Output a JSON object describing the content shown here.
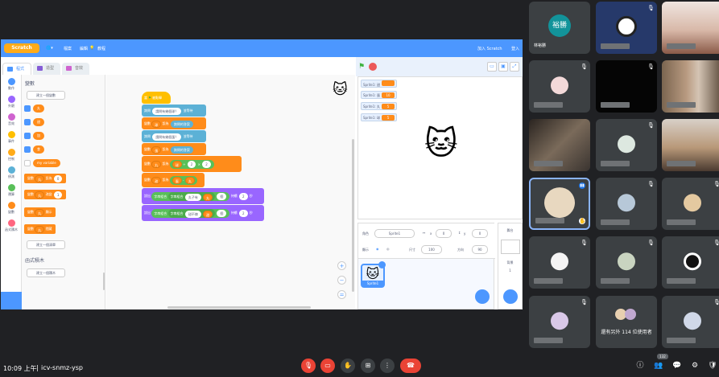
{
  "scratch": {
    "logo": "Scratch",
    "menu": {
      "file": "檔案",
      "edit": "編輯",
      "tutorials": "教程",
      "signup": "加入 Scratch",
      "signin": "登入"
    },
    "tabs": {
      "code": "程式",
      "costumes": "造型",
      "sounds": "音效"
    },
    "categories": [
      {
        "label": "動作",
        "color": "#4c97ff"
      },
      {
        "label": "外觀",
        "color": "#9966ff"
      },
      {
        "label": "音效",
        "color": "#cf63cf"
      },
      {
        "label": "事件",
        "color": "#ffbf00"
      },
      {
        "label": "控制",
        "color": "#ffab19"
      },
      {
        "label": "偵測",
        "color": "#5cb1d6"
      },
      {
        "label": "運算",
        "color": "#59c059"
      },
      {
        "label": "變數",
        "color": "#ff8c1a"
      },
      {
        "label": "函式積木",
        "color": "#ff6680"
      }
    ],
    "palette": {
      "heading": "變數",
      "make_var": "建立一個變數",
      "vars": [
        "丸",
        "甜",
        "加",
        "食",
        "my variable"
      ],
      "blocks": [
        {
          "t1": "變數",
          "var": "丸",
          "t2": "設為",
          "val": "0"
        },
        {
          "t1": "變數",
          "var": "丸",
          "t2": "改變",
          "val": "1"
        },
        {
          "t1": "變數",
          "var": "丸",
          "t2": "顯示",
          "val": ""
        },
        {
          "t1": "變數",
          "var": "丸",
          "t2": "隱藏",
          "val": ""
        }
      ],
      "make_list": "建立一個清單",
      "myblocks_heading": "函式積木",
      "make_block": "建立一個積木"
    },
    "code": {
      "hat": {
        "when": "當",
        "rest": "被點擊"
      },
      "ask1": {
        "verb": "詢問",
        "q": "請問有幾個球？",
        "wait": "並等待"
      },
      "set1": {
        "pre": "變數",
        "var": "球",
        "mid": "設為",
        "val": "詢問的答案"
      },
      "ask2": {
        "verb": "詢問",
        "q": "請問有幾個蛋？",
        "wait": "並等待"
      },
      "set2": {
        "pre": "變數",
        "var": "蛋",
        "mid": "設為",
        "val": "詢問的答案"
      },
      "set3": {
        "pre": "變數",
        "var": "丸",
        "mid": "設為",
        "a": "球",
        "b": "2",
        "c": "2"
      },
      "set4": {
        "pre": "變數",
        "var": "甜",
        "mid": "設為",
        "a": "蛋",
        "b": "丸"
      },
      "say1": {
        "verb": "說出",
        "j1": "字串組合",
        "j2": "字串組合",
        "t": "丸子有",
        "v": "丸",
        "u": "個",
        "dur": "持續",
        "sec": "2",
        "unit": "秒"
      },
      "say2": {
        "verb": "說出",
        "j1": "字串組合",
        "j2": "字串組合",
        "t": "甜不辣",
        "v": "甜",
        "u": "個",
        "dur": "持續",
        "sec": "2",
        "unit": "秒"
      }
    },
    "monitors": [
      {
        "name": "Sprite1: 甜",
        "value": ""
      },
      {
        "name": "Sprite1: 蛋",
        "value": "10"
      },
      {
        "name": "Sprite1: 丸",
        "value": "5"
      },
      {
        "name": "Sprite1: 球",
        "value": "5"
      }
    ],
    "sprite_pane": {
      "sprite_label": "角色",
      "sprite_name": "Sprite1",
      "x_label": "x",
      "x": "0",
      "y_label": "y",
      "y": "0",
      "show_label": "顯示",
      "size_label": "尺寸",
      "size": "100",
      "dir_label": "方向",
      "dir": "90",
      "thumb_name": "Sprite1"
    },
    "stage_pane": {
      "title": "舞台",
      "backdrop_label": "背景",
      "backdrop_count": "1"
    }
  },
  "participants": [
    {
      "name": "林裕勝",
      "initial": "裕勝",
      "kind": "initial"
    },
    {
      "kind": "icon",
      "name": ""
    },
    {
      "kind": "photo",
      "name": ""
    },
    {
      "kind": "avatar",
      "name": ""
    },
    {
      "kind": "dark",
      "name": ""
    },
    {
      "kind": "photo",
      "name": ""
    },
    {
      "kind": "photo",
      "name": ""
    },
    {
      "kind": "avatar",
      "name": ""
    },
    {
      "kind": "photo",
      "name": ""
    },
    {
      "kind": "active",
      "name": ""
    },
    {
      "kind": "avatar",
      "name": ""
    },
    {
      "kind": "avatar",
      "name": ""
    },
    {
      "kind": "avatar",
      "name": ""
    },
    {
      "kind": "avatar",
      "name": ""
    },
    {
      "kind": "avatar",
      "name": ""
    },
    {
      "kind": "avatar",
      "name": ""
    },
    {
      "kind": "more",
      "name": "",
      "text": "還有另外 114 位使用者"
    },
    {
      "kind": "avatar",
      "name": ""
    }
  ],
  "bottom": {
    "time": "10:09 上午",
    "separator": "|",
    "meeting_code": "icv-snmz-ysp",
    "people_count": "132"
  }
}
